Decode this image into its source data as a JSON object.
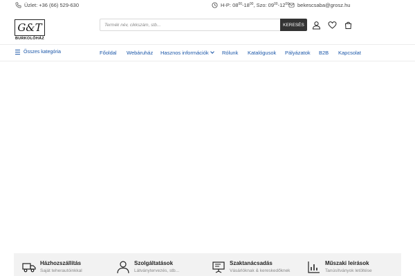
{
  "topbar": {
    "phone": "Üzlet: +36 (66) 529-630",
    "hours": {
      "label": "H-P: ",
      "wd_open": "08",
      "wd_open_sup": "00",
      "sep1": "-",
      "wd_close": "18",
      "wd_close_sup": "00",
      "sat_label": ", Szo: ",
      "sat_open": "09",
      "sat_open_sup": "00",
      "sep2": "-",
      "sat_close": "12",
      "sat_close_sup": "00"
    },
    "email": "bekescsaba@grosz.hu"
  },
  "logo": {
    "mark": "G&T",
    "sub": "BURKOLÓHÁZ"
  },
  "search": {
    "placeholder": "Termék név, cikkszám, stb...",
    "button": "KERESÉS"
  },
  "header_icons": [
    "user-icon",
    "heart-icon",
    "cart-icon"
  ],
  "nav": {
    "all_categories": "Összes kategória",
    "items": [
      "Főoldal",
      "Webáruház",
      "Hasznos információk",
      "Rólunk",
      "Katalógusok",
      "Pályázatok",
      "B2B",
      "Kapcsolat"
    ]
  },
  "features": [
    {
      "title": "Házhozszállítás",
      "sub": "Saját teherautóinkkal",
      "icon": "truck-icon"
    },
    {
      "title": "Szolgáltatások",
      "sub": "Látványtervezés, stb...",
      "icon": "person-icon"
    },
    {
      "title": "Szaktanácsadás",
      "sub": "Vásárlóknak & kereskedőknek",
      "icon": "presentation-icon"
    },
    {
      "title": "Műszaki leírások",
      "sub": "Tanúsítványok letöltése",
      "icon": "chart-icon"
    }
  ],
  "colors": {
    "nav_link": "#1a56a8",
    "search_button": "#333333",
    "features_bg": "#f2f2f2"
  }
}
